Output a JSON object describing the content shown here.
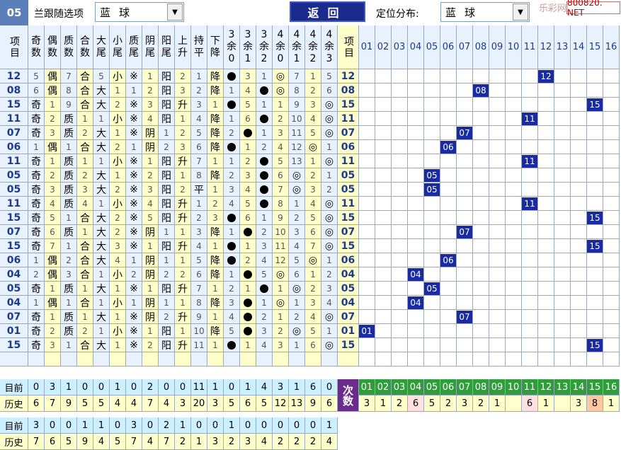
{
  "toolbar": {
    "issue_no": "05",
    "follow_label": "兰跟随选项",
    "follow_value": "蓝球",
    "back_label": "返回",
    "position_label": "定位分布:",
    "position_value": "蓝球",
    "watermark": "乐彩网",
    "site": "800820. NET"
  },
  "headers": {
    "item": "项目",
    "cols": [
      "奇数",
      "偶数",
      "质数",
      "合数",
      "大尾",
      "小尾",
      "质尾",
      "阴尾",
      "阳尾",
      "上升",
      "持平",
      "下降",
      "3余0",
      "3余1",
      "3余2",
      "4余0",
      "4余1",
      "4余2",
      "4余3"
    ],
    "numbers": [
      "01",
      "02",
      "03",
      "04",
      "05",
      "06",
      "07",
      "08",
      "09",
      "10",
      "11",
      "12",
      "13",
      "14",
      "15",
      "16"
    ]
  },
  "rows": [
    {
      "id": "12",
      "cells": [
        "5",
        "偶",
        "7",
        "合",
        "5",
        "小",
        "※",
        "1",
        "阳",
        "2",
        "1",
        "降",
        "●",
        "3",
        "1",
        "◎",
        "7",
        "1",
        "5"
      ],
      "mark": 12
    },
    {
      "id": "08",
      "cells": [
        "6",
        "偶",
        "8",
        "合",
        "大",
        "1",
        "1",
        "2",
        "阳",
        "3",
        "2",
        "降",
        "1",
        "4",
        "●",
        "◎",
        "8",
        "2",
        "6"
      ],
      "mark": 8
    },
    {
      "id": "15",
      "cells": [
        "奇",
        "1",
        "9",
        "合",
        "大",
        "2",
        "※",
        "3",
        "阳",
        "升",
        "3",
        "1",
        "●",
        "5",
        "1",
        "1",
        "9",
        "3",
        "◎"
      ],
      "mark": 15
    },
    {
      "id": "11",
      "cells": [
        "奇",
        "2",
        "质",
        "1",
        "1",
        "小",
        "※",
        "4",
        "阳",
        "1",
        "4",
        "降",
        "1",
        "6",
        "●",
        "2",
        "10",
        "4",
        "◎"
      ],
      "mark": 11
    },
    {
      "id": "07",
      "cells": [
        "奇",
        "3",
        "质",
        "2",
        "大",
        "1",
        "※",
        "阴",
        "1",
        "2",
        "5",
        "降",
        "2",
        "●",
        "1",
        "3",
        "11",
        "5",
        "◎"
      ],
      "mark": 7
    },
    {
      "id": "06",
      "cells": [
        "1",
        "偶",
        "1",
        "合",
        "大",
        "2",
        "1",
        "阴",
        "2",
        "3",
        "6",
        "降",
        "●",
        "1",
        "2",
        "4",
        "12",
        "◎",
        "1"
      ],
      "mark": 6
    },
    {
      "id": "11",
      "cells": [
        "奇",
        "1",
        "质",
        "1",
        "1",
        "小",
        "※",
        "1",
        "阳",
        "升",
        "7",
        "1",
        "1",
        "2",
        "●",
        "5",
        "13",
        "1",
        "◎"
      ],
      "mark": 11
    },
    {
      "id": "05",
      "cells": [
        "奇",
        "2",
        "质",
        "2",
        "大",
        "1",
        "※",
        "2",
        "阳",
        "1",
        "8",
        "降",
        "2",
        "3",
        "●",
        "6",
        "◎",
        "2",
        "1"
      ],
      "mark": 5
    },
    {
      "id": "05",
      "cells": [
        "奇",
        "3",
        "质",
        "3",
        "大",
        "2",
        "※",
        "3",
        "阳",
        "2",
        "平",
        "1",
        "3",
        "4",
        "●",
        "7",
        "◎",
        "3",
        "2"
      ],
      "mark": 5
    },
    {
      "id": "11",
      "cells": [
        "奇",
        "4",
        "质",
        "4",
        "1",
        "小",
        "※",
        "4",
        "阳",
        "升",
        "1",
        "2",
        "4",
        "5",
        "●",
        "8",
        "1",
        "4",
        "◎"
      ],
      "mark": 11
    },
    {
      "id": "15",
      "cells": [
        "奇",
        "5",
        "1",
        "合",
        "大",
        "2",
        "※",
        "5",
        "阳",
        "升",
        "2",
        "3",
        "●",
        "6",
        "1",
        "9",
        "2",
        "5",
        "◎"
      ],
      "mark": 15
    },
    {
      "id": "07",
      "cells": [
        "奇",
        "6",
        "质",
        "1",
        "大",
        "2",
        "※",
        "阴",
        "1",
        "1",
        "3",
        "降",
        "1",
        "●",
        "2",
        "10",
        "3",
        "6",
        "◎"
      ],
      "mark": 7
    },
    {
      "id": "15",
      "cells": [
        "奇",
        "7",
        "1",
        "合",
        "大",
        "3",
        "※",
        "1",
        "阳",
        "升",
        "4",
        "1",
        "●",
        "1",
        "3",
        "11",
        "4",
        "7",
        "◎"
      ],
      "mark": 15
    },
    {
      "id": "06",
      "cells": [
        "1",
        "偶",
        "2",
        "合",
        "大",
        "4",
        "1",
        "阴",
        "1",
        "1",
        "5",
        "降",
        "●",
        "2",
        "4",
        "12",
        "5",
        "◎",
        "1"
      ],
      "mark": 6
    },
    {
      "id": "04",
      "cells": [
        "2",
        "偶",
        "3",
        "合",
        "1",
        "小",
        "2",
        "阴",
        "2",
        "2",
        "6",
        "降",
        "1",
        "●",
        "5",
        "◎",
        "6",
        "1",
        "2"
      ],
      "mark": 4
    },
    {
      "id": "05",
      "cells": [
        "奇",
        "1",
        "质",
        "1",
        "大",
        "1",
        "※",
        "1",
        "阳",
        "升",
        "7",
        "1",
        "2",
        "1",
        "●",
        "1",
        "◎",
        "2",
        "3"
      ],
      "mark": 5
    },
    {
      "id": "04",
      "cells": [
        "1",
        "偶",
        "1",
        "合",
        "1",
        "小",
        "1",
        "阴",
        "1",
        "1",
        "8",
        "降",
        "3",
        "●",
        "1",
        "◎",
        "1",
        "3",
        "4"
      ],
      "mark": 4
    },
    {
      "id": "07",
      "cells": [
        "奇",
        "1",
        "质",
        "1",
        "大",
        "1",
        "※",
        "阴",
        "2",
        "升",
        "9",
        "1",
        "4",
        "●",
        "2",
        "1",
        "2",
        "4",
        "◎"
      ],
      "mark": 7
    },
    {
      "id": "01",
      "cells": [
        "奇",
        "2",
        "质",
        "2",
        "1",
        "小",
        "※",
        "1",
        "阳",
        "1",
        "10",
        "降",
        "5",
        "●",
        "3",
        "2",
        "◎",
        "5",
        "1"
      ],
      "mark": 1
    },
    {
      "id": "15",
      "cells": [
        "奇",
        "3",
        "1",
        "合",
        "大",
        "1",
        "※",
        "2",
        "阳",
        "升",
        "11",
        "1",
        "●",
        "1",
        "4",
        "3",
        "1",
        "6",
        "◎"
      ],
      "mark": 15
    }
  ],
  "summary": {
    "current_label": "目前",
    "history_label": "历史",
    "current": [
      "0",
      "3",
      "1",
      "0",
      "0",
      "1",
      "0",
      "2",
      "0",
      "0",
      "11",
      "1",
      "0",
      "1",
      "4",
      "3",
      "1",
      "6",
      "0"
    ],
    "history": [
      "6",
      "7",
      "9",
      "5",
      "5",
      "4",
      "4",
      "7",
      "4",
      "3",
      "20",
      "3",
      "5",
      "6",
      "5",
      "12",
      "13",
      "9",
      "6"
    ],
    "count_label": "次数",
    "count_numbers": [
      "01",
      "02",
      "03",
      "04",
      "05",
      "06",
      "07",
      "08",
      "09",
      "10",
      "11",
      "12",
      "13",
      "14",
      "15",
      "16"
    ],
    "counts": [
      "3",
      "1",
      "2",
      "6",
      "5",
      "2",
      "3",
      "2",
      "1",
      "",
      "6",
      "1",
      "",
      "3",
      "8",
      "1"
    ]
  },
  "summary2": {
    "current_label": "目前",
    "history_label": "历史",
    "current": [
      "3",
      "0",
      "0",
      "1",
      "1",
      "0",
      "3",
      "0",
      "2",
      "1",
      "0",
      "0",
      "1",
      "0",
      "0",
      "0",
      "0",
      "0",
      "1"
    ],
    "history": [
      "7",
      "6",
      "5",
      "9",
      "4",
      "5",
      "7",
      "4",
      "7",
      "2",
      "1",
      "3",
      "2",
      "3",
      "4",
      "2",
      "2",
      "2",
      "4"
    ]
  },
  "colors": {
    "accent": "#1a2ba0",
    "header": "#e8f2ff",
    "yellow": "#ffffcc",
    "green": "#2f9e3a",
    "purple": "#6a2b8c"
  }
}
